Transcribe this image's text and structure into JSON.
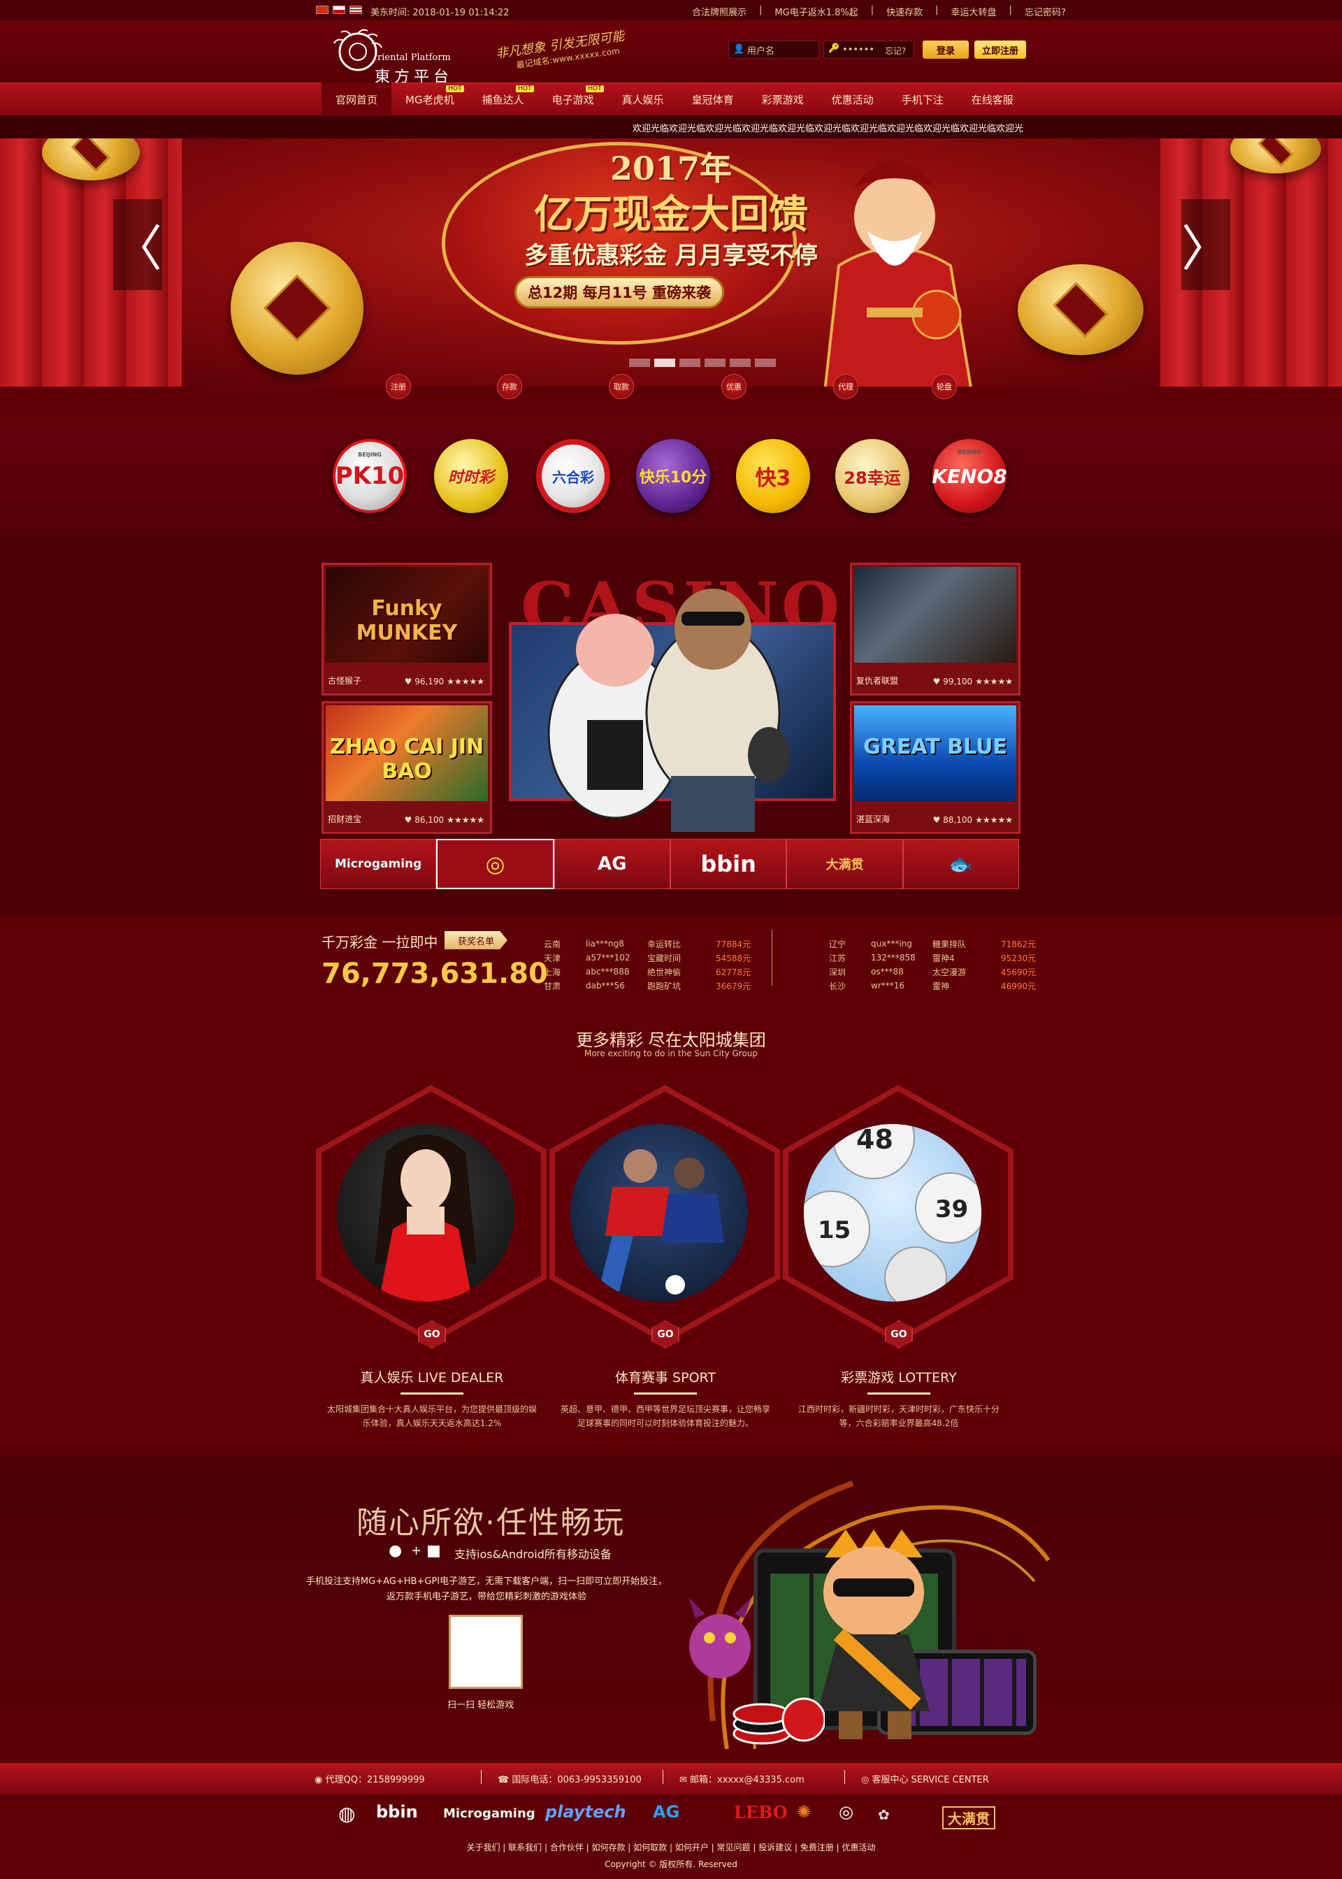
{
  "topbar": {
    "time_label": "美东时间: 2018-01-19 01:14:22",
    "links": [
      "合法牌照展示",
      "MG电子返水1.8%起",
      "快速存款",
      "幸运大转盘",
      "忘记密码?"
    ]
  },
  "header": {
    "logo_en": "riental Platform",
    "logo_cn": "東方平台",
    "slogan": "非凡想象 引发无限可能",
    "domain": "最记域名:www.xxxxx.com",
    "username_placeholder": "用户名",
    "password_placeholder": "••••••",
    "forgot_label": "忘记?",
    "login_label": "登录",
    "register_label": "立即注册"
  },
  "nav": [
    {
      "label": "官网首页",
      "hot": false
    },
    {
      "label": "MG老虎机",
      "hot": true
    },
    {
      "label": "捕鱼达人",
      "hot": true
    },
    {
      "label": "电子游戏",
      "hot": true
    },
    {
      "label": "真人娱乐",
      "hot": false
    },
    {
      "label": "皇冠体育",
      "hot": false
    },
    {
      "label": "彩票游戏",
      "hot": false
    },
    {
      "label": "优惠活动",
      "hot": false
    },
    {
      "label": "手机下注",
      "hot": false
    },
    {
      "label": "在线客服",
      "hot": false
    }
  ],
  "marquee": "欢迎光临欢迎光临欢迎光临欢迎光临欢迎光临欢迎光临欢迎光临欢迎光临欢迎光临欢迎光临欢迎光",
  "banner": {
    "year": "2017年",
    "title": "亿万现金大回馈",
    "subtitle": "多重优惠彩金 月月享受不停",
    "plate": "总12期 每月11号 重磅来袭",
    "prev_arrow": "〈",
    "next_arrow": "〉",
    "slide_count": 6,
    "active_slide": 1
  },
  "quick_links": [
    "注册",
    "存款",
    "取款",
    "优惠",
    "代理",
    "轮盘"
  ],
  "lotteries": [
    "PK10",
    "时时彩",
    "六合彩",
    "快乐10分",
    "快3",
    "28幸运",
    "KENO8"
  ],
  "lottery_sublabels": [
    "BEIJING",
    "",
    "",
    "",
    "",
    "",
    "BEIJING"
  ],
  "games": [
    {
      "img_text": "Funky MUNKEY",
      "name": "古怪猴子",
      "likes": "96,190",
      "stars": "★★★★★"
    },
    {
      "img_text": "ZHAO CAI JIN BAO",
      "name": "招财进宝",
      "likes": "86,100",
      "stars": "★★★★★"
    },
    {
      "img_text": "",
      "name": "复仇者联盟",
      "likes": "99,100",
      "stars": "★★★★★"
    },
    {
      "img_text": "GREAT BLUE",
      "name": "湛蓝深海",
      "likes": "88,100",
      "stars": "★★★★★"
    }
  ],
  "casino_word": "CASINO",
  "providers": [
    "Microgaming",
    "◎",
    "AG",
    "bbin",
    "大满贯",
    "🐟"
  ],
  "jackpot": {
    "label": "千万彩金 一拉即中",
    "button": "获奖名单",
    "amount": "76,773,631.80",
    "left": [
      [
        "云南",
        "lia***ng8",
        "幸运转比",
        "77884元"
      ],
      [
        "天津",
        "a57***102",
        "宝藏时间",
        "54588元"
      ],
      [
        "上海",
        "abc***888",
        "绝世神偷",
        "62778元"
      ],
      [
        "甘肃",
        "dab***56",
        "跑跑矿坑",
        "36679元"
      ]
    ],
    "right": [
      [
        "辽宁",
        "qux***ing",
        "糖果排队",
        "71862元"
      ],
      [
        "江苏",
        "132***858",
        "雷神4",
        "95230元"
      ],
      [
        "深圳",
        "os***88",
        "太空漫游",
        "45690元"
      ],
      [
        "长沙",
        "wr***16",
        "雷神",
        "46990元"
      ]
    ]
  },
  "more": {
    "title": "更多精彩 尽在太阳城集团",
    "subtitle": "More exciting to do in the Sun City Group",
    "go_label": "GO",
    "categories": [
      {
        "title": "真人娱乐 LIVE DEALER",
        "desc": "太阳城集团集合十大真人娱乐平台，为您提供最顶级的娱乐体验，真人娱乐天天返水高达1.2%"
      },
      {
        "title": "体育赛事 SPORT",
        "desc": "英超、意甲、德甲、西甲等世界足坛顶尖赛事，让您畅享足球赛事的同时可以时刻体验体育投注的魅力。"
      },
      {
        "title": "彩票游戏 LOTTERY",
        "desc": "江西时时彩，新疆时时彩，天津时时彩，广东快乐十分等，六合彩赔率业界最高48.2倍"
      }
    ],
    "ball_numbers": [
      "48",
      "39",
      "15"
    ]
  },
  "mobile": {
    "title": "随心所欲·任性畅玩",
    "support": "支持ios&Android所有移动设备",
    "desc": "手机投注支持MG+AG+HB+GPI电子游艺，无需下载客户端，扫一扫即可立即开始投注，返万款手机电子游艺，带给您精彩刺激的游戏体验",
    "qr_caption": "扫一扫 轻松游戏"
  },
  "contact": [
    "代理QQ：2158999999",
    "国际电话：0063-9953359100",
    "邮箱：xxxxx@43335.com",
    "客服中心 SERVICE CENTER"
  ],
  "partners": [
    "bbin",
    "Microgaming",
    "playtech",
    "AG",
    "LEBO",
    "大满贯"
  ],
  "footer_links": "关于我们 | 联系我们 | 合作伙伴 | 如何存款 | 如何取款 | 如何开户 | 常见问题 | 投诉建议 | 免费注册 | 优惠活动",
  "copyright": "Copyright © 版权所有. Reserved",
  "colors": {
    "bg": "#5e0008",
    "nav": "#b3121a",
    "gold": "#ffc94a",
    "amount_red": "#ff7a3c"
  }
}
